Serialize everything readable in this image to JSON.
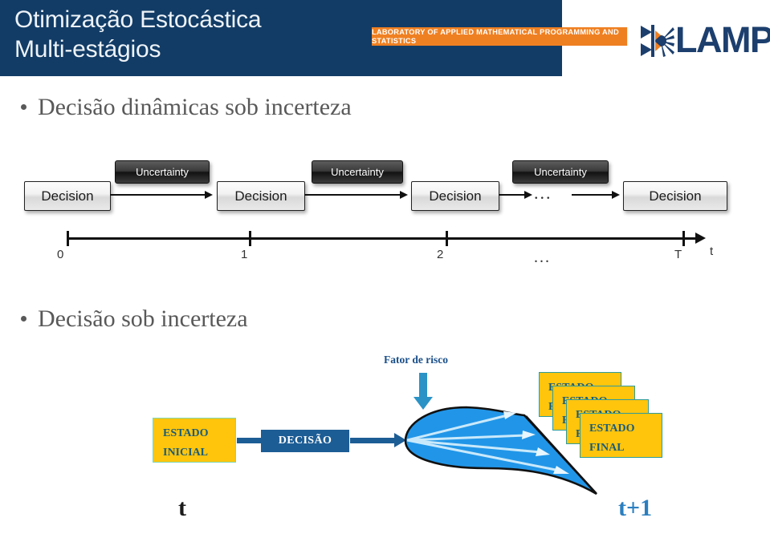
{
  "header": {
    "title": "Otimização Estocástica\nMulti-estágios",
    "logo": {
      "banner_text": "LABORATORY OF APPLIED MATHEMATICAL PROGRAMMING AND STATISTICS",
      "wordmark": "LAMPS",
      "banner_color": "#ef8022",
      "wordmark_color": "#1c3f6e",
      "band_color": "#123c66"
    }
  },
  "bullets": [
    {
      "text": "Decisão dinâmicas sob incerteza"
    },
    {
      "text": "Decisão sob incerteza"
    }
  ],
  "stage_diagram": {
    "decisions": [
      {
        "label": "Decision"
      },
      {
        "label": "Decision"
      },
      {
        "label": "Decision"
      },
      {
        "label": "Decision"
      }
    ],
    "uncertainties": [
      {
        "label": "Uncertainty"
      },
      {
        "label": "Uncertainty"
      },
      {
        "label": "Uncertainty"
      }
    ],
    "ellipsis": "...",
    "timeline": {
      "ticks": [
        "0",
        "1",
        "2",
        "T"
      ],
      "ellipsis": "...",
      "axis_label": "t"
    }
  },
  "lower_diagram": {
    "estado_inicial": "ESTADO\nINICIAL",
    "decisao": "DECISÃO",
    "fator_de_risco": "Fator de risco",
    "estados_finais": [
      {
        "label": "ESTADO\nFINAL"
      },
      {
        "label": "ESTADO\nFINAL"
      },
      {
        "label": "ESTADO\nFINAL"
      },
      {
        "label": "ESTADO\nFINAL"
      }
    ],
    "time_left": "t",
    "time_right": "t+1",
    "colors": {
      "estado_fill": "#ffc50d",
      "estado_text": "#1a5c7a",
      "decisao_fill": "#1d5d95",
      "fan_fill": "#2196e8",
      "risk_arrow": "#2b93c6"
    }
  }
}
